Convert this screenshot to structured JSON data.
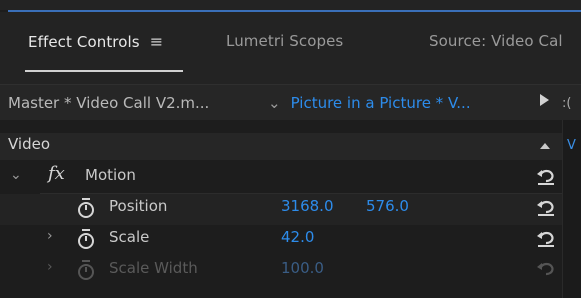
{
  "tabs": {
    "effect_controls": "Effect Controls",
    "menu_glyph": "≡",
    "lumetri_scopes": "Lumetri Scopes",
    "source": "Source: Video Cal"
  },
  "header": {
    "master_clip": "Master * Video Call V2.m...",
    "chevron": "⌄",
    "sequence_clip": "Picture in a Picture * V...",
    "timeline_peek": ":("
  },
  "sections": {
    "video": "Video"
  },
  "motion": {
    "fx_glyph": "fx",
    "label": "Motion",
    "properties": [
      {
        "label": "Position",
        "value1": "3168.0",
        "value2": "576.0"
      },
      {
        "label": "Scale",
        "value1": "42.0"
      },
      {
        "label": "Scale Width",
        "value1": "100.0"
      }
    ]
  },
  "right_strip": {
    "letter": "V"
  },
  "colors": {
    "accent_blue": "#2d8ceb",
    "panel_bg": "#1d1d1d",
    "header_bg": "#262626"
  },
  "icons": [
    "menu-icon",
    "chevron-down-icon",
    "play-triangle-icon",
    "collapse-up-icon",
    "stopwatch-icon",
    "reset-arrow-icon",
    "chevron-right-icon"
  ]
}
